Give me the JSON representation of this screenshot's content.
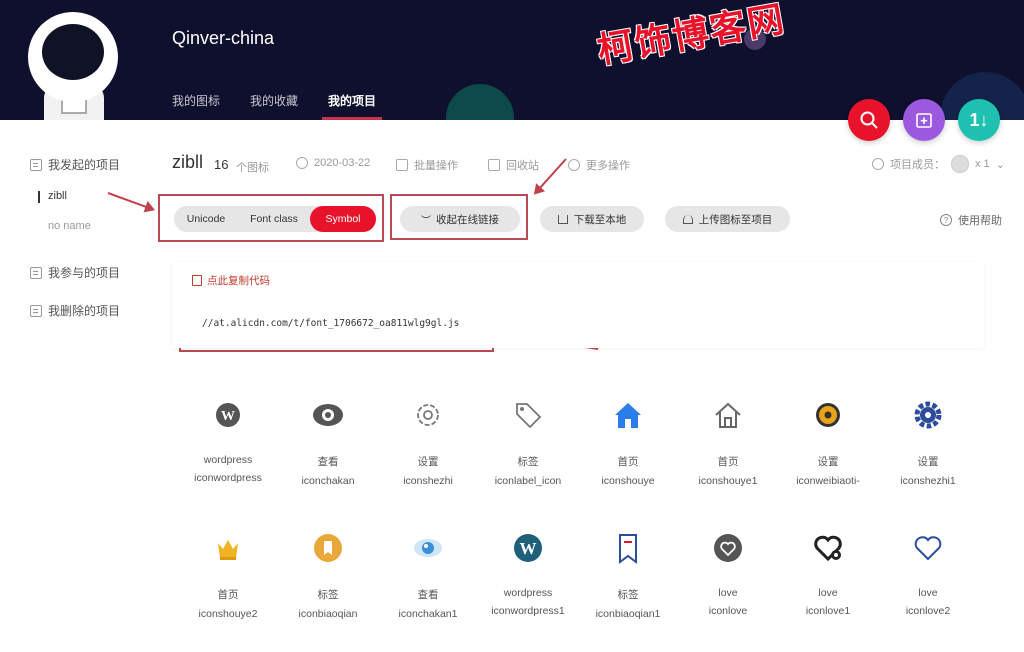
{
  "header": {
    "username": "Qinver-china",
    "watermark": "柯饰博客网",
    "tabs": [
      {
        "label": "我的图标",
        "active": false
      },
      {
        "label": "我的收藏",
        "active": false
      },
      {
        "label": "我的项目",
        "active": true
      }
    ]
  },
  "sidebar": {
    "initiated": "我发起的项目",
    "projects": [
      "zibll",
      "no name"
    ],
    "joined": "我参与的项目",
    "deleted": "我删除的项目"
  },
  "project": {
    "name": "zibll",
    "count": "16",
    "count_unit": "个图标",
    "date": "2020-03-22",
    "batch": "批量操作",
    "recycle": "回收站",
    "more": "更多操作",
    "members_label": "项目成员：",
    "members_count": "x 1"
  },
  "toolbar": {
    "formats": [
      "Unicode",
      "Font class",
      "Symbol"
    ],
    "active_format": "Symbol",
    "collapse_link": "收起在线链接",
    "download": "下载至本地",
    "upload": "上传图标至项目",
    "help": "使用帮助"
  },
  "code": {
    "copy": "点此复制代码",
    "url": "//at.alicdn.com/t/font_1706672_oa811wlg9gl.js"
  },
  "icons": [
    {
      "name": "wordpress",
      "code": "iconwordpress",
      "glyph": "wordpress-icon",
      "color": "#555555"
    },
    {
      "name": "查看",
      "code": "iconchakan",
      "glyph": "eye-icon",
      "color": "#555555"
    },
    {
      "name": "设置",
      "code": "iconshezhi",
      "glyph": "gear-outline-icon",
      "color": "#777777"
    },
    {
      "name": "标签",
      "code": "iconlabel_icon",
      "glyph": "tag-icon",
      "color": "#777777"
    },
    {
      "name": "首页",
      "code": "iconshouye",
      "glyph": "home-filled-icon",
      "color": "#2b7de9"
    },
    {
      "name": "首页",
      "code": "iconshouye1",
      "glyph": "home-outline-icon",
      "color": "#666666"
    },
    {
      "name": "设置",
      "code": "iconweibiaoti-",
      "glyph": "gear-color-icon",
      "color": "#e8a317"
    },
    {
      "name": "设置",
      "code": "iconshezhi1",
      "glyph": "gear-blue-icon",
      "color": "#2b4c9c"
    },
    {
      "name": "首页",
      "code": "iconshouye2",
      "glyph": "crown-icon",
      "color": "#f0b323"
    },
    {
      "name": "标签",
      "code": "iconbiaoqian",
      "glyph": "coin-icon",
      "color": "#e8a83a"
    },
    {
      "name": "查看",
      "code": "iconchakan1",
      "glyph": "eye-color-icon",
      "color": "#3a8fd6"
    },
    {
      "name": "wordpress",
      "code": "iconwordpress1",
      "glyph": "wordpress-teal-icon",
      "color": "#1e5f7a"
    },
    {
      "name": "标签",
      "code": "iconbiaoqian1",
      "glyph": "bookmark-icon",
      "color": "#2b4c9c"
    },
    {
      "name": "love",
      "code": "iconlove",
      "glyph": "heart-circle-icon",
      "color": "#555555"
    },
    {
      "name": "love",
      "code": "iconlove1",
      "glyph": "heart-broken-icon",
      "color": "#222222"
    },
    {
      "name": "love",
      "code": "iconlove2",
      "glyph": "heart-outline-icon",
      "color": "#2b4c9c"
    }
  ]
}
